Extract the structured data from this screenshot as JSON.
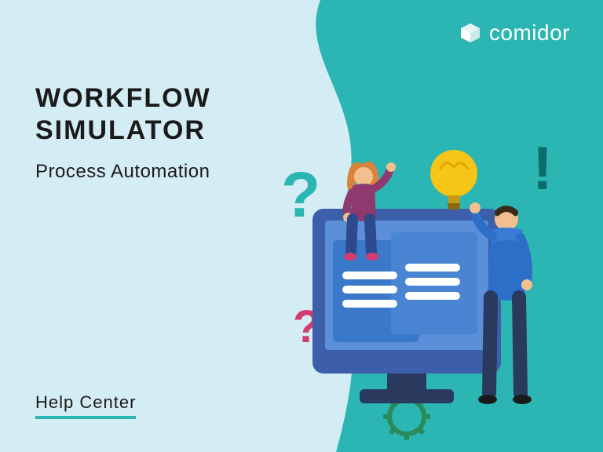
{
  "brand": {
    "name": "comidor"
  },
  "heading": {
    "title_line1": "WORKFLOW",
    "title_line2": "SIMULATOR",
    "subtitle": "Process Automation"
  },
  "footer": {
    "help_center": "Help Center"
  },
  "colors": {
    "background": "#d4ecf4",
    "teal": "#2bb6b3",
    "dark_teal": "#0d6b6b",
    "monitor": "#3d5ea8",
    "screen_light": "#5b8fd9",
    "screen_panel": "#3a78c9",
    "bulb": "#f5c518",
    "magenta": "#d33c6f",
    "person1_top": "#8e3a6e",
    "person1_hair": "#d9843a",
    "person1_pants": "#2d4a8c",
    "person2_shirt": "#2d6ec9",
    "person2_pants": "#2a3a5e",
    "skin": "#f2c08f"
  }
}
